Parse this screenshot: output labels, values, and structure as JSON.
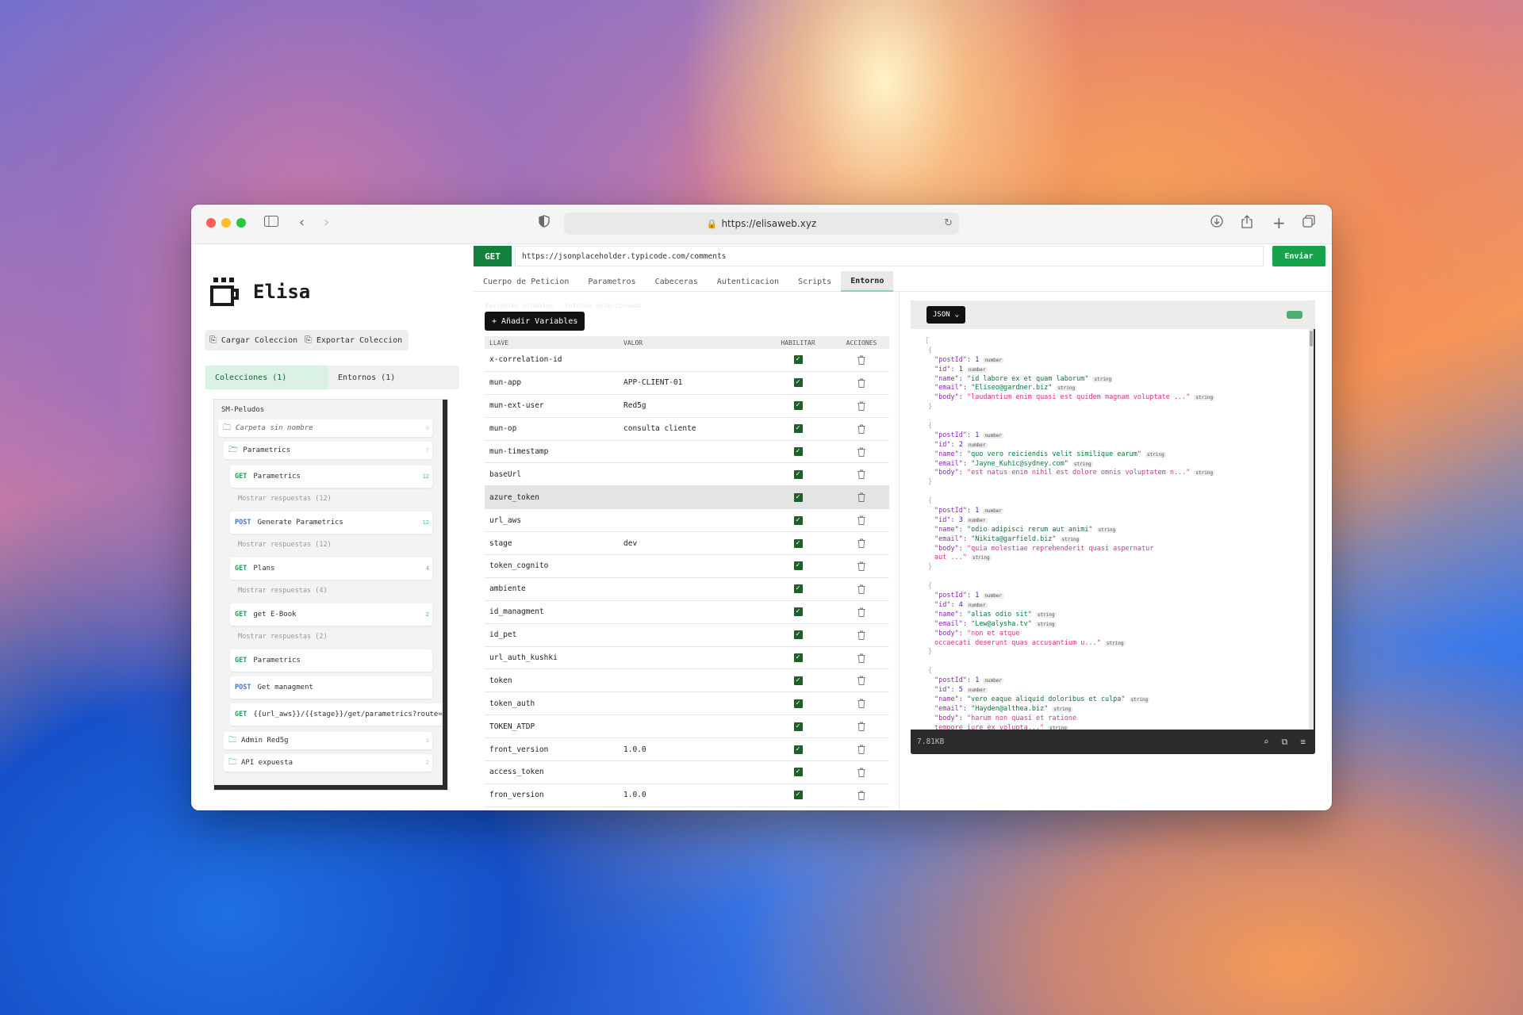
{
  "browser": {
    "url": "https://elisaweb.xyz"
  },
  "app": {
    "name": "Elisa",
    "load_collection": "Cargar Coleccion",
    "export_collection": "Exportar Coleccion",
    "tabs": [
      "Colecciones (1)",
      "Entornos (1)"
    ]
  },
  "tree": {
    "root": "SM-Peludos",
    "items": [
      {
        "type": "folder",
        "label": "Carpeta sin nombre",
        "count": "0"
      },
      {
        "type": "folder",
        "label": "Parametrics",
        "count": "7"
      },
      {
        "type": "request",
        "method": "GET",
        "label": "Parametrics",
        "count": "12"
      },
      {
        "type": "responses",
        "label": "Mostrar respuestas (12)"
      },
      {
        "type": "request",
        "method": "POST",
        "label": "Generate Parametrics",
        "count": "12"
      },
      {
        "type": "responses",
        "label": "Mostrar respuestas (12)"
      },
      {
        "type": "request",
        "method": "GET",
        "label": "Plans",
        "count": "4"
      },
      {
        "type": "responses",
        "label": "Mostrar respuestas (4)"
      },
      {
        "type": "request",
        "method": "GET",
        "label": "get E-Book",
        "count": "2"
      },
      {
        "type": "responses",
        "label": "Mostrar respuestas (2)"
      },
      {
        "type": "request",
        "method": "GET",
        "label": "Parametrics",
        "count": ""
      },
      {
        "type": "request",
        "method": "POST",
        "label": "Get managment",
        "count": ""
      },
      {
        "type": "request",
        "method": "GET",
        "label": "{{url_aws}}/{{stage}}/get/parametrics?route=citi",
        "count": ""
      },
      {
        "type": "folder",
        "label": "Admin Red5g",
        "count": "3"
      },
      {
        "type": "folder",
        "label": "API expuesta",
        "count": "2"
      }
    ]
  },
  "request": {
    "method": "GET",
    "url": "https://jsonplaceholder.typicode.com/comments",
    "send": "Enviar",
    "tabs": [
      "Cuerpo de Peticion",
      "Parametros",
      "Cabeceras",
      "Autenticacion",
      "Scripts",
      "Entorno"
    ],
    "active_tab": "Entorno"
  },
  "env": {
    "ghost_title": "Variables globales · Entorno seleccionado",
    "add_button": "+ Añadir Variables",
    "headers": [
      "LLAVE",
      "VALOR",
      "HABILITAR",
      "ACCIONES"
    ],
    "rows": [
      {
        "key": "x-correlation-id",
        "value": ""
      },
      {
        "key": "mun-app",
        "value": "APP-CLIENT-01"
      },
      {
        "key": "mun-ext-user",
        "value": "Red5g"
      },
      {
        "key": "mun-op",
        "value": "consulta cliente"
      },
      {
        "key": "mun-timestamp",
        "value": ""
      },
      {
        "key": "baseUrl",
        "value": ""
      },
      {
        "key": "azure_token",
        "value": ""
      },
      {
        "key": "url_aws",
        "value": ""
      },
      {
        "key": "stage",
        "value": "dev"
      },
      {
        "key": "token_cognito",
        "value": ""
      },
      {
        "key": "ambiente",
        "value": ""
      },
      {
        "key": "id_managment",
        "value": ""
      },
      {
        "key": "id_pet",
        "value": ""
      },
      {
        "key": "url_auth_kushki",
        "value": ""
      },
      {
        "key": "token",
        "value": ""
      },
      {
        "key": "token_auth",
        "value": ""
      },
      {
        "key": "TOKEN_ATDP",
        "value": ""
      },
      {
        "key": "front_version",
        "value": "1.0.0"
      },
      {
        "key": "access_token",
        "value": ""
      },
      {
        "key": "fron_version",
        "value": "1.0.0"
      }
    ]
  },
  "response": {
    "format": "JSON",
    "size": "7.81KB",
    "items": [
      {
        "postId": "1",
        "id": "1",
        "name": "\"id labore ex et quam laborum\"",
        "email": "\"Eliseo@gardner.biz\"",
        "body": [
          "\"laudantium enim quasi est quidem magnam voluptate ...\""
        ]
      },
      {
        "postId": "1",
        "id": "2",
        "name": "\"quo vero reiciendis velit similique earum\"",
        "email": "\"Jayne_Kuhic@sydney.com\"",
        "body": [
          "\"est natus enim nihil est dolore omnis voluptatem n...\""
        ]
      },
      {
        "postId": "1",
        "id": "3",
        "name": "\"odio adipisci rerum aut animi\"",
        "email": "\"Nikita@garfield.biz\"",
        "body": [
          "\"quia molestiae reprehenderit quasi aspernatur",
          "aut ...\""
        ]
      },
      {
        "postId": "1",
        "id": "4",
        "name": "\"alias odio sit\"",
        "email": "\"Lew@alysha.tv\"",
        "body": [
          "\"non et atque",
          "occaecati deserunt quas accusantium u...\""
        ]
      },
      {
        "postId": "1",
        "id": "5",
        "name": "\"vero eaque aliquid doloribus et culpa\"",
        "email": "\"Hayden@althea.biz\"",
        "body": [
          "\"harum non quasi et ratione",
          "tempore iure ex volupta...\""
        ]
      }
    ],
    "type_number": "number",
    "type_string": "string"
  }
}
